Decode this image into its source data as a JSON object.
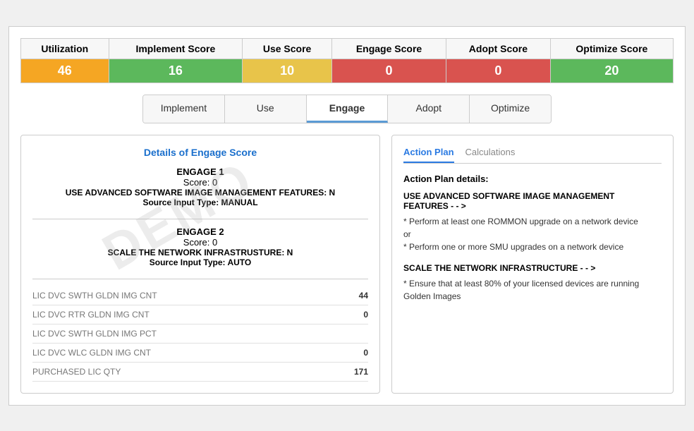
{
  "scores": {
    "headers": [
      "Utilization",
      "Implement Score",
      "Use Score",
      "Engage Score",
      "Adopt Score",
      "Optimize Score"
    ],
    "values": [
      "46",
      "16",
      "10",
      "0",
      "0",
      "20"
    ],
    "colors": [
      "score-orange",
      "score-green",
      "score-yellow",
      "score-red",
      "score-red",
      "score-green2"
    ]
  },
  "tabs": {
    "items": [
      "Implement",
      "Use",
      "Engage",
      "Adopt",
      "Optimize"
    ],
    "active": "Engage"
  },
  "left_panel": {
    "title": "Details of Engage Score",
    "engage1": {
      "section": "ENGAGE 1",
      "score": "Score: 0",
      "desc": "USE ADVANCED SOFTWARE IMAGE MANAGEMENT FEATURES: N",
      "source": "Source Input Type: MANUAL"
    },
    "engage2": {
      "section": "ENGAGE 2",
      "score": "Score: 0",
      "desc": "SCALE THE NETWORK INFRASTRUSTURE: N",
      "source": "Source Input Type: AUTO"
    },
    "data_rows": [
      {
        "label": "LIC DVC SWTH GLDN IMG CNT",
        "value": "44"
      },
      {
        "label": "LIC DVC RTR GLDN IMG CNT",
        "value": "0"
      },
      {
        "label": "LIC DVC SWTH GLDN IMG PCT",
        "value": ""
      },
      {
        "label": "LIC DVC WLC GLDN IMG CNT",
        "value": "0"
      },
      {
        "label": "PURCHASED LIC QTY",
        "value": "171"
      }
    ]
  },
  "right_panel": {
    "tabs": [
      "Action Plan",
      "Calculations"
    ],
    "active_tab": "Action Plan",
    "plan_title": "Action Plan details:",
    "actions": [
      {
        "heading": "USE ADVANCED SOFTWARE IMAGE MANAGEMENT FEATURES - - >",
        "detail": "* Perform at least one ROMMON upgrade on a network device\nor\n* Perform one or more SMU upgrades on a network device"
      },
      {
        "heading": "SCALE THE NETWORK INFRASTRUCTURE - - >",
        "detail": "* Ensure that at least 80% of your licensed devices are running Golden Images"
      }
    ]
  },
  "watermark": "DEMO"
}
